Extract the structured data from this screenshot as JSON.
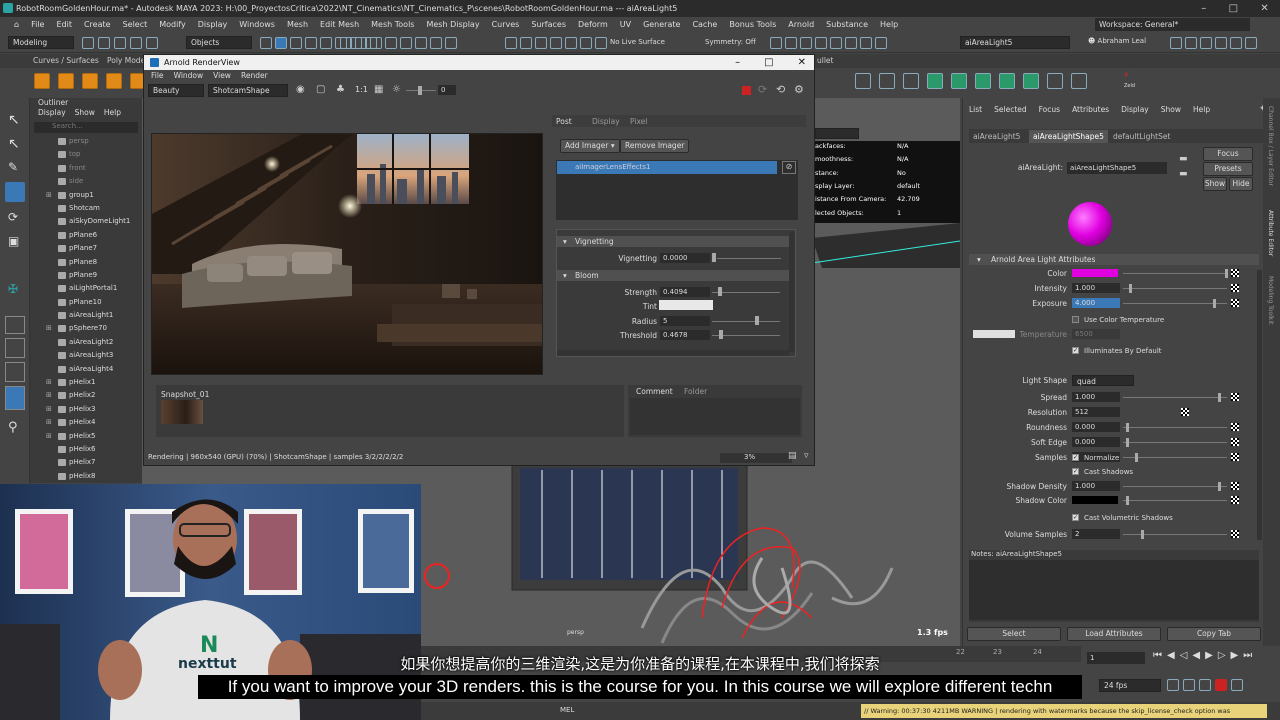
{
  "window": {
    "title": "RobotRoomGoldenHour.ma* - Autodesk MAYA 2023: H:\\00_ProyectosCritica\\2022\\NT_Cinematics\\NT_Cinematics_P\\scenes\\RobotRoomGoldenHour.ma   ---   aiAreaLight5"
  },
  "menu": [
    "File",
    "Edit",
    "Create",
    "Select",
    "Modify",
    "Display",
    "Windows",
    "Mesh",
    "Edit Mesh",
    "Mesh Tools",
    "Mesh Display",
    "Curves",
    "Surfaces",
    "Deform",
    "UV",
    "Generate",
    "Cache",
    "Bonus Tools",
    "Arnold",
    "Substance",
    "Help"
  ],
  "workspace": "Workspace: General*",
  "status": {
    "mode": "Modeling",
    "objects": "Objects",
    "live": "No Live Surface",
    "symmetry": "Symmetry: Off",
    "node": "aiAreaLight5",
    "user": "Abraham Leal"
  },
  "shelf": {
    "tab1": "Curves / Surfaces",
    "tab2": "Poly Mode",
    "tab_right": "ullet",
    "zeld": "Zeld"
  },
  "outliner": {
    "title": "Outliner",
    "menu": [
      "Display",
      "Show",
      "Help"
    ],
    "search": "Search...",
    "items": [
      {
        "label": "persp",
        "gray": true
      },
      {
        "label": "top",
        "gray": true
      },
      {
        "label": "front",
        "gray": true
      },
      {
        "label": "side",
        "gray": true
      },
      {
        "label": "group1",
        "gray": false,
        "expand": true
      },
      {
        "label": "Shotcam",
        "gray": false
      },
      {
        "label": "aiSkyDomeLight1",
        "gray": false
      },
      {
        "label": "pPlane6",
        "gray": false
      },
      {
        "label": "pPlane7",
        "gray": false
      },
      {
        "label": "pPlane8",
        "gray": false
      },
      {
        "label": "pPlane9",
        "gray": false
      },
      {
        "label": "aiLightPortal1",
        "gray": false
      },
      {
        "label": "pPlane10",
        "gray": false
      },
      {
        "label": "aiAreaLight1",
        "gray": false
      },
      {
        "label": "pSphere70",
        "gray": false,
        "expand": true
      },
      {
        "label": "aiAreaLight2",
        "gray": false
      },
      {
        "label": "aiAreaLight3",
        "gray": false
      },
      {
        "label": "aiAreaLight4",
        "gray": false
      },
      {
        "label": "pHelix1",
        "gray": false,
        "expand": true
      },
      {
        "label": "pHelix2",
        "gray": false,
        "expand": true
      },
      {
        "label": "pHelix3",
        "gray": false,
        "expand": true
      },
      {
        "label": "pHelix4",
        "gray": false,
        "expand": true
      },
      {
        "label": "pHelix5",
        "gray": false,
        "expand": true
      },
      {
        "label": "pHelix6",
        "gray": false
      },
      {
        "label": "pHelix7",
        "gray": false
      },
      {
        "label": "pHelix8",
        "gray": false
      }
    ]
  },
  "renderview": {
    "title": "Arnold RenderView",
    "menu": [
      "File",
      "Window",
      "View",
      "Render"
    ],
    "aov": "Beauty",
    "camera": "ShotcamShape",
    "ratio": "1:1",
    "exposure": "0",
    "tabs": [
      "Post",
      "Display",
      "Pixel"
    ],
    "add_imager": "Add Imager",
    "remove_imager": "Remove Imager",
    "imager": "aiImagerLensEffects1",
    "vignetting": {
      "title": "Vignetting",
      "label": "Vignetting",
      "value": "0.0000"
    },
    "bloom": {
      "title": "Bloom",
      "strength_label": "Strength",
      "strength": "0.4094",
      "tint_label": "Tint",
      "radius_label": "Radius",
      "radius": "5",
      "threshold_label": "Threshold",
      "threshold": "0.4678"
    },
    "snapshot": "Snapshot_01",
    "bottom_tabs": [
      "Comment",
      "Folder"
    ],
    "status": "Rendering | 960x540 (GPU) (70%) | ShotcamShape | samples 3/2/2/2/2/2",
    "percent": "3%"
  },
  "hud": [
    {
      "label": "ackfaces:",
      "value": "N/A"
    },
    {
      "label": "moothness:",
      "value": "N/A"
    },
    {
      "label": "stance:",
      "value": "No"
    },
    {
      "label": "splay Layer:",
      "value": "default"
    },
    {
      "label": "istance From Camera:",
      "value": "42.709"
    },
    {
      "label": "lected Objects:",
      "value": "1"
    }
  ],
  "viewport": {
    "camera": "persp",
    "fps": "1.3 fps"
  },
  "attr": {
    "menu": [
      "List",
      "Selected",
      "Focus",
      "Attributes",
      "Display",
      "Show",
      "Help"
    ],
    "tabs": [
      "aiAreaLight5",
      "aiAreaLightShape5",
      "defaultLightSet"
    ],
    "node_label": "aiAreaLight:",
    "node_value": "aiAreaLightShape5",
    "focus": "Focus",
    "presets": "Presets",
    "show": "Show",
    "hide": "Hide",
    "section": "Arnold Area Light Attributes",
    "color_label": "Color",
    "intensity_label": "Intensity",
    "intensity": "1.000",
    "exposure_label": "Exposure",
    "exposure": "4.000",
    "use_temp": "Use Color Temperature",
    "temp_label": "Temperature",
    "temp": "6500",
    "illum": "Illuminates By Default",
    "shape_label": "Light Shape",
    "shape": "quad",
    "spread_label": "Spread",
    "spread": "1.000",
    "res_label": "Resolution",
    "res": "512",
    "round_label": "Roundness",
    "round": "0.000",
    "soft_label": "Soft Edge",
    "soft": "0.000",
    "samples_label": "Samples",
    "samples": "1",
    "normalize": "Normalize",
    "cast": "Cast Shadows",
    "sdens_label": "Shadow Density",
    "sdens": "1.000",
    "scol_label": "Shadow Color",
    "cvol": "Cast Volumetric Shadows",
    "vsamp_label": "Volume Samples",
    "vsamp": "2",
    "notes": "Notes:  aiAreaLightShape5",
    "select": "Select",
    "load": "Load Attributes",
    "copy": "Copy Tab",
    "side_tabs": [
      "Channel Box / Layer Editor",
      "Attribute Editor",
      "Modeling Toolkit"
    ]
  },
  "timeline": {
    "frame": "1",
    "fps": "24 fps",
    "ticks": [
      "22",
      "23",
      "24"
    ]
  },
  "cmd": {
    "lang": "MEL",
    "warning": "// Warning: 00:37:30  4211MB WARNING | rendering with watermarks because the skip_license_check option was"
  },
  "subtitles": {
    "zh": "如果你想提高你的三维渲染,这是为你准备的课程,在本课程中,我们将探索",
    "en": "If you want to improve your 3D renders. this is the course for you. In this course we will explore different techn"
  },
  "webcam": {
    "shirt": "nexttut"
  },
  "colors": {
    "accent": "#3a79b5",
    "light_color": "#e000e0",
    "maya_teal": "#2aa3a7"
  }
}
